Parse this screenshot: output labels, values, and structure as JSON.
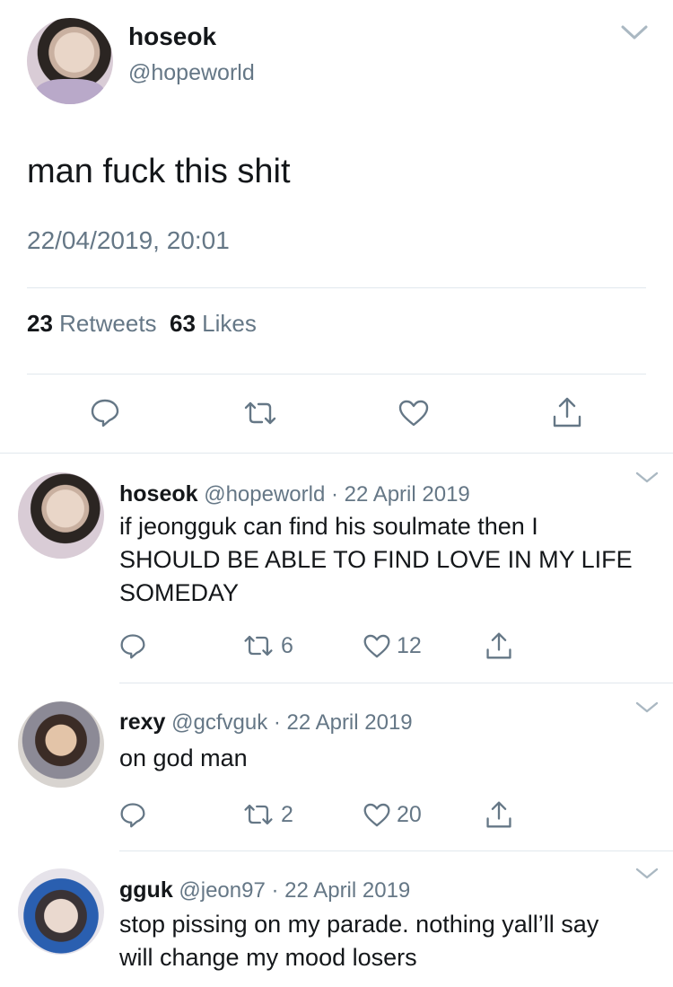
{
  "main_tweet": {
    "display_name": "hoseok",
    "handle": "@hopeworld",
    "text": "man fuck this shit",
    "timestamp": "22/04/2019, 20:01",
    "retweet_count": "23",
    "retweet_label": "Retweets",
    "like_count": "63",
    "like_label": "Likes"
  },
  "replies": [
    {
      "display_name": "hoseok",
      "handle": "@hopeworld",
      "separator": "·",
      "date": "22 April 2019",
      "text": "if jeongguk can find his soulmate then I SHOULD BE ABLE TO FIND LOVE IN MY LIFE SOMEDAY",
      "retweets": "6",
      "likes": "12"
    },
    {
      "display_name": "rexy",
      "handle": "@gcfvguk",
      "separator": "·",
      "date": "22 April 2019",
      "text": "on god man",
      "retweets": "2",
      "likes": "20"
    },
    {
      "display_name": "gguk",
      "handle": "@jeon97",
      "separator": "·",
      "date": "22 April 2019",
      "text": "stop pissing on my parade. nothing yall’ll say will change my mood losers"
    }
  ],
  "icons": {
    "reply": "reply-icon",
    "retweet": "retweet-icon",
    "like": "heart-icon",
    "share": "share-icon",
    "menu": "chevron-down-icon"
  },
  "colors": {
    "text": "#14171a",
    "secondary": "#657786",
    "divider": "#e1e8ed"
  }
}
